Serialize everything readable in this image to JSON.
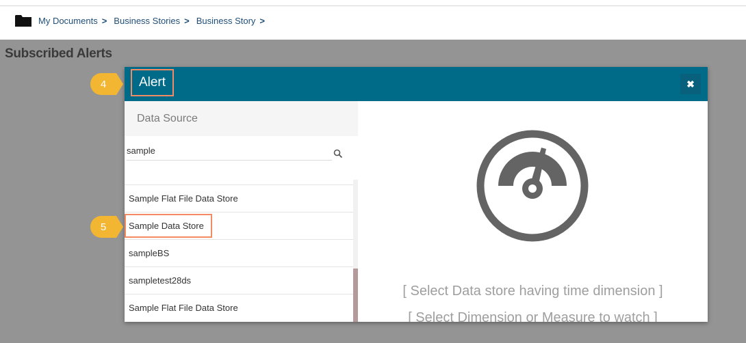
{
  "breadcrumb": {
    "items": [
      "My Documents",
      "Business Stories",
      "Business Story"
    ],
    "separator": ">"
  },
  "page": {
    "title": "Subscribed Alerts"
  },
  "modal": {
    "title": "Alert",
    "close_icon": "close-icon",
    "data_source_header": "Data Source",
    "search": {
      "value": "sample",
      "icon": "search-icon"
    },
    "list_items": [
      "Sample Flat File Data Store",
      "Sample Data Store",
      "sampleBS",
      "sampletest28ds",
      "Sample Flat File Data Store"
    ],
    "selected_item": "Sample Data Store",
    "placeholder_icon": "gauge-icon",
    "hints": [
      "[ Select Data store having time dimension ]",
      "[ Select Dimension or Measure to watch ]"
    ]
  },
  "callouts": [
    "4",
    "5"
  ],
  "colors": {
    "header": "#006a89",
    "callout": "#f2b632",
    "highlight_border": "#f28b64",
    "overlay": "#949494"
  }
}
